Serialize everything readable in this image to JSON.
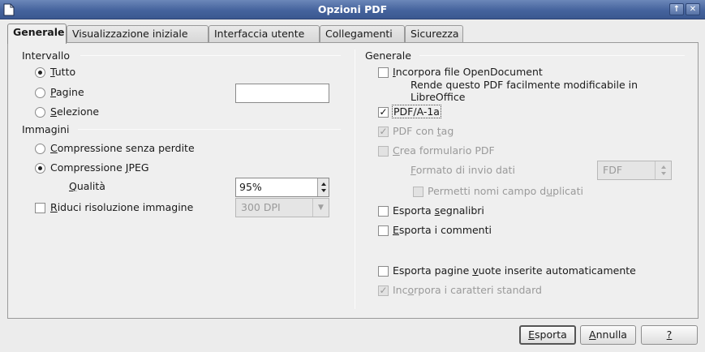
{
  "window": {
    "title": "Opzioni PDF"
  },
  "titlebar_buttons": {
    "up": "↑",
    "close": "✕"
  },
  "tabs": [
    {
      "label": "Generale",
      "active": true
    },
    {
      "label": "Visualizzazione iniziale",
      "active": false
    },
    {
      "label": "Interfaccia utente",
      "active": false
    },
    {
      "label": "Collegamenti",
      "active": false
    },
    {
      "label": "Sicurezza",
      "active": false
    }
  ],
  "left": {
    "range": {
      "title": "Intervallo",
      "all": {
        "key": "T",
        "rest": "utto",
        "selected": true
      },
      "pages": {
        "key": "P",
        "rest": "agine",
        "value": ""
      },
      "selection": {
        "key": "S",
        "rest": "elezione"
      }
    },
    "images": {
      "title": "Immagini",
      "lossless": {
        "key": "C",
        "rest": "ompressione senza perdite"
      },
      "jpeg": {
        "pre": "Compressione ",
        "key": "J",
        "rest": "PEG",
        "selected": true
      },
      "quality": {
        "key": "Q",
        "rest": "ualità",
        "value": "95%"
      },
      "reduce": {
        "key": "R",
        "rest": "iduci risoluzione immagine",
        "checked": false,
        "dpi": "300 DPI"
      }
    }
  },
  "right": {
    "title": "Generale",
    "embed_odf": {
      "key": "I",
      "rest": "ncorpora file OpenDocument",
      "checked": false,
      "desc1": "Rende questo PDF facilmente modificabile in",
      "desc2": "LibreOffice"
    },
    "pdfa": {
      "label": "PDF/A-1a",
      "checked": true
    },
    "tagged": {
      "pre": "PDF con ",
      "key": "t",
      "rest": "ag",
      "checked": true
    },
    "form": {
      "key": "C",
      "rest": "rea formulario PDF",
      "checked": false
    },
    "submit_format": {
      "key": "F",
      "rest": "ormato di invio dati",
      "value": "FDF"
    },
    "dup_names": {
      "pre": "Permetti nomi campo d",
      "key": "u",
      "rest": "plicati",
      "checked": false
    },
    "bookmarks": {
      "pre": "Esporta ",
      "key": "s",
      "rest": "egnalibri",
      "checked": false
    },
    "comments": {
      "key": "E",
      "rest": "sporta i commenti",
      "checked": false
    },
    "blank_pages": {
      "pre": "Esporta pagine ",
      "key": "v",
      "rest": "uote inserite automaticamente",
      "checked": false
    },
    "std_fonts": {
      "pre": "Inc",
      "key": "o",
      "rest": "rpora i caratteri standard",
      "checked": true
    }
  },
  "footer": {
    "export": {
      "key": "E",
      "rest": "sporta"
    },
    "cancel": {
      "key": "A",
      "rest": "nnulla"
    },
    "help": {
      "key": "?",
      "rest": ""
    }
  },
  "colors": {
    "titlebar": "#45639d",
    "title_text": "#ffffff",
    "disabled_text": "#9a9a9a"
  }
}
